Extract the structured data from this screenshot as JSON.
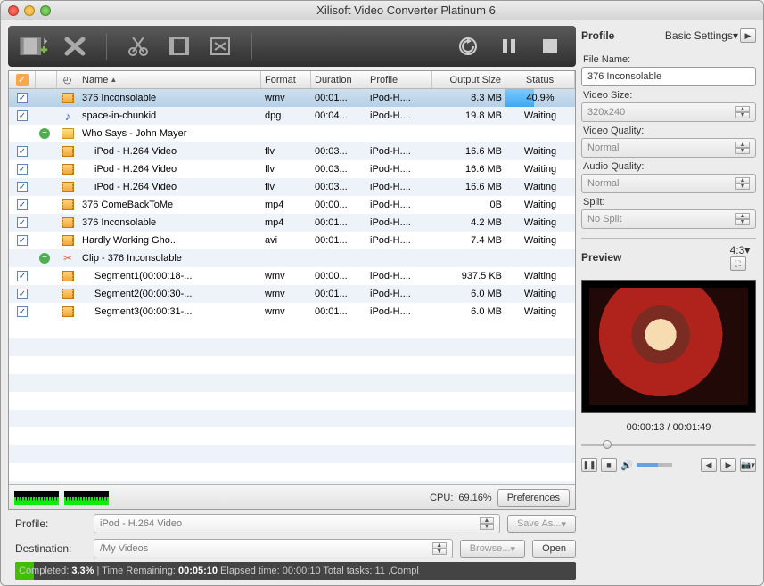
{
  "window": {
    "title": "Xilisoft Video Converter Platinum 6"
  },
  "columns": {
    "name": "Name",
    "format": "Format",
    "duration": "Duration",
    "profile": "Profile",
    "size": "Output Size",
    "status": "Status"
  },
  "rows": [
    {
      "checked": true,
      "selected": true,
      "indent": 0,
      "type": "video",
      "name": "376 Inconsolable",
      "format": "wmv",
      "duration": "00:01...",
      "profile": "iPod-H....",
      "size": "8.3 MB",
      "status": "40.9%",
      "progress": 40.9
    },
    {
      "checked": true,
      "indent": 0,
      "type": "music",
      "name": "space-in-chunkid",
      "format": "dpg",
      "duration": "00:04...",
      "profile": "iPod-H....",
      "size": "19.8 MB",
      "status": "Waiting"
    },
    {
      "expand": "-",
      "indent": 0,
      "type": "folder",
      "name": "Who Says - John Mayer",
      "format": "",
      "duration": "",
      "profile": "",
      "size": "",
      "status": ""
    },
    {
      "checked": true,
      "indent": 1,
      "type": "video",
      "name": "iPod - H.264 Video",
      "format": "flv",
      "duration": "00:03...",
      "profile": "iPod-H....",
      "size": "16.6 MB",
      "status": "Waiting"
    },
    {
      "checked": true,
      "indent": 1,
      "type": "video",
      "name": "iPod - H.264 Video",
      "format": "flv",
      "duration": "00:03...",
      "profile": "iPod-H....",
      "size": "16.6 MB",
      "status": "Waiting"
    },
    {
      "checked": true,
      "indent": 1,
      "type": "video",
      "name": "iPod - H.264 Video",
      "format": "flv",
      "duration": "00:03...",
      "profile": "iPod-H....",
      "size": "16.6 MB",
      "status": "Waiting"
    },
    {
      "checked": true,
      "indent": 0,
      "type": "video",
      "name": "376 ComeBackToMe",
      "format": "mp4",
      "duration": "00:00...",
      "profile": "iPod-H....",
      "size": "0B",
      "status": "Waiting"
    },
    {
      "checked": true,
      "indent": 0,
      "type": "video",
      "name": "376 Inconsolable",
      "format": "mp4",
      "duration": "00:01...",
      "profile": "iPod-H....",
      "size": "4.2 MB",
      "status": "Waiting"
    },
    {
      "checked": true,
      "indent": 0,
      "type": "video",
      "name": "Hardly Working  Gho...",
      "format": "avi",
      "duration": "00:01...",
      "profile": "iPod-H....",
      "size": "7.4 MB",
      "status": "Waiting"
    },
    {
      "expand": "-",
      "indent": 0,
      "type": "clip",
      "name": "Clip - 376 Inconsolable",
      "format": "",
      "duration": "",
      "profile": "",
      "size": "",
      "status": ""
    },
    {
      "checked": true,
      "indent": 1,
      "type": "video",
      "name": "Segment1(00:00:18-...",
      "format": "wmv",
      "duration": "00:00...",
      "profile": "iPod-H....",
      "size": "937.5 KB",
      "status": "Waiting"
    },
    {
      "checked": true,
      "indent": 1,
      "type": "video",
      "name": "Segment2(00:00:30-...",
      "format": "wmv",
      "duration": "00:01...",
      "profile": "iPod-H....",
      "size": "6.0 MB",
      "status": "Waiting"
    },
    {
      "checked": true,
      "indent": 1,
      "type": "video",
      "name": "Segment3(00:00:31-...",
      "format": "wmv",
      "duration": "00:01...",
      "profile": "iPod-H....",
      "size": "6.0 MB",
      "status": "Waiting"
    }
  ],
  "cpu": {
    "label": "CPU:",
    "value": "69.16%",
    "prefs": "Preferences"
  },
  "profile_row": {
    "label": "Profile:",
    "value": "iPod - H.264 Video",
    "save": "Save As..."
  },
  "dest_row": {
    "label": "Destination:",
    "value": "/My Videos",
    "browse": "Browse...",
    "open": "Open"
  },
  "footer": {
    "text_a": "Completed: ",
    "pct": "3.3%",
    "text_b": " | Time Remaining: ",
    "remain": "00:05:10",
    "text_c": " Elapsed time: 00:00:10 Total tasks: 11 ,Compl"
  },
  "side": {
    "head": "Profile",
    "basic": "Basic Settings",
    "filename_lbl": "File Name:",
    "filename": "376 Inconsolable",
    "vsize_lbl": "Video Size:",
    "vsize": "320x240",
    "vq_lbl": "Video Quality:",
    "vq": "Normal",
    "aq_lbl": "Audio Quality:",
    "aq": "Normal",
    "split_lbl": "Split:",
    "split": "No Split"
  },
  "preview": {
    "head": "Preview",
    "ratio": "4:3",
    "time": "00:00:13 / 00:01:49",
    "pos_pct": 12
  }
}
